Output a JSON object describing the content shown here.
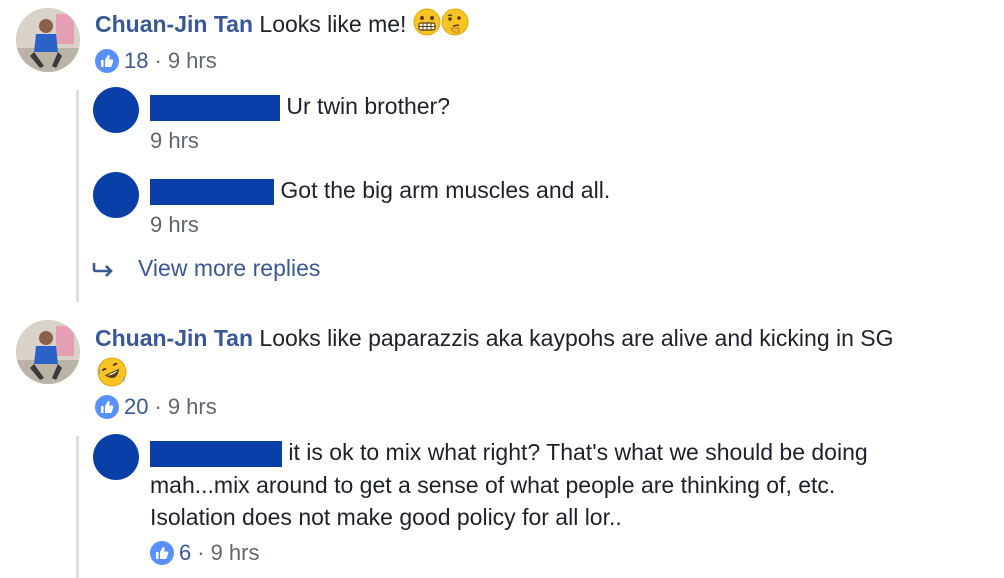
{
  "colors": {
    "link": "#385898",
    "like_blue": "#5890ff",
    "redaction": "#0a3fa8",
    "meta_gray": "#616770"
  },
  "comments": [
    {
      "author": "Chuan-Jin Tan",
      "text": "Looks like me!",
      "emojis": [
        "grimacing-face",
        "thinking-face"
      ],
      "likes": "18",
      "separator": "·",
      "time": "9 hrs",
      "replies": [
        {
          "text": "Ur twin brother?",
          "time": "9 hrs"
        },
        {
          "text": "Got the big arm muscles and all.",
          "time": "9 hrs"
        }
      ],
      "view_more_replies": "View more replies"
    },
    {
      "author": "Chuan-Jin Tan",
      "text": "Looks like paparazzis aka kaypohs are alive and kicking in SG",
      "emojis": [
        "rolling-on-floor-laughing-face"
      ],
      "likes": "20",
      "separator": "·",
      "time": "9 hrs",
      "replies": [
        {
          "lines": [
            "it is ok to mix what right? That's what we should be doing",
            "mah...mix around to get a sense of what people are thinking of, etc.",
            "Isolation does not make good policy for all lor.."
          ],
          "likes": "6",
          "separator": "·",
          "time": "9 hrs"
        }
      ]
    }
  ]
}
